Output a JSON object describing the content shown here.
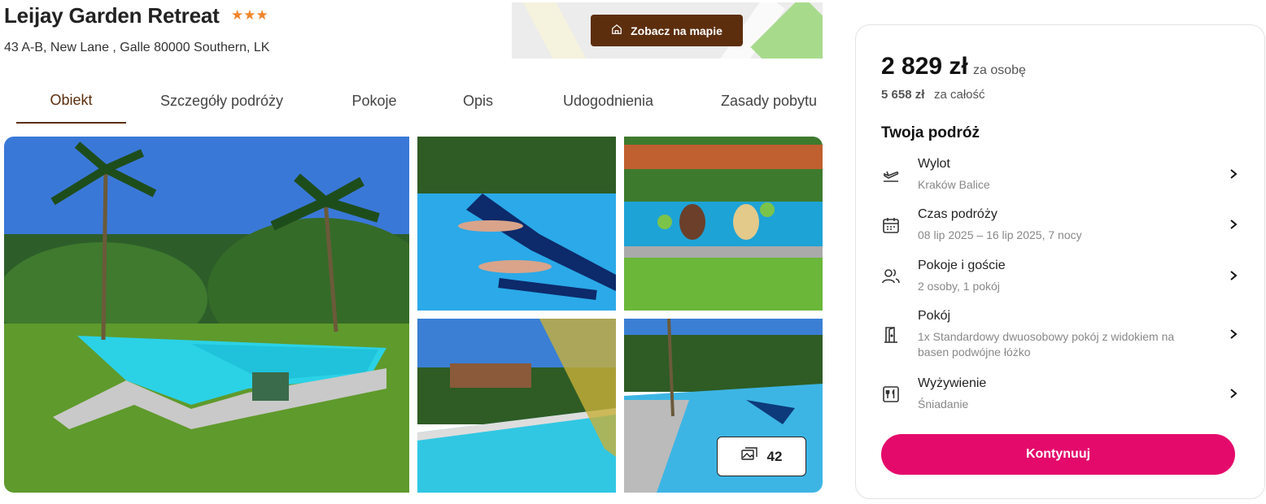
{
  "hotel": {
    "name": "Leijay Garden Retreat",
    "stars": "★★★",
    "address": "43 A-B, New Lane , Galle 80000 Southern, LK"
  },
  "map": {
    "button_label": "Zobacz na mapie",
    "icon": "home-icon"
  },
  "tabs": [
    {
      "label": "Obiekt",
      "active": true
    },
    {
      "label": "Szczegóły podróży"
    },
    {
      "label": "Pokoje"
    },
    {
      "label": "Opis"
    },
    {
      "label": "Udogodnienia"
    },
    {
      "label": "Zasady pobytu"
    }
  ],
  "gallery": {
    "photo_count": "42",
    "icon": "images-icon"
  },
  "booking": {
    "price": "2 829 zł",
    "price_unit": "za osobę",
    "total": "5 658 zł",
    "total_unit": "za całość",
    "trip_heading": "Twoja podróż",
    "items": [
      {
        "label": "Wylot",
        "value": "Kraków Balice",
        "icon": "plane-departure-icon"
      },
      {
        "label": "Czas podróży",
        "value": "08 lip 2025 – 16 lip 2025, 7 nocy",
        "icon": "calendar-icon"
      },
      {
        "label": "Pokoje i goście",
        "value": "2 osoby, 1 pokój",
        "icon": "users-icon"
      },
      {
        "label": "Pokój",
        "value": "1x Standardowy dwuosobowy pokój z widokiem na basen podwójne łóżko",
        "icon": "door-icon"
      },
      {
        "label": "Wyżywienie",
        "value": "Śniadanie",
        "icon": "cutlery-icon"
      }
    ],
    "cta_label": "Kontynuuj"
  },
  "colors": {
    "brand_brown": "#5c2e0e",
    "cta_pink": "#e40a6b",
    "star_orange": "#f0852a"
  }
}
